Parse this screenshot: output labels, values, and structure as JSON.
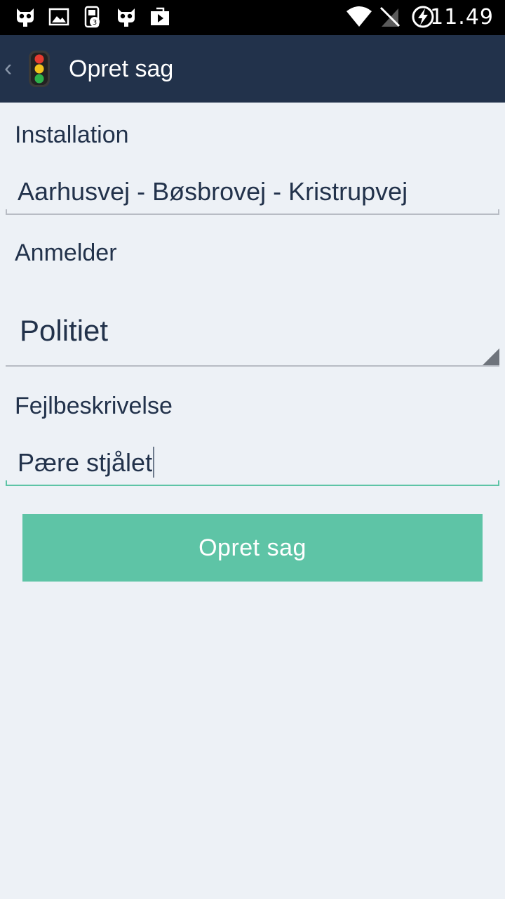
{
  "status_bar": {
    "time": "11.49",
    "notification_icons": [
      "cyanogen-mod-icon",
      "image-icon",
      "sim-notification-icon",
      "cyanogen-mod-icon",
      "video-store-icon"
    ],
    "notification_badge": "3",
    "system_icons": [
      "wifi-icon",
      "no-signal-icon",
      "battery-charging-icon"
    ]
  },
  "action_bar": {
    "title": "Opret sag",
    "back_icon": "chevron-left-icon",
    "logo_icon": "traffic-light-icon",
    "background": "#22324b"
  },
  "form": {
    "installation": {
      "label": "Installation",
      "value": "Aarhusvej - Bøsbrovej - Kristrupvej"
    },
    "reporter": {
      "label": "Anmelder",
      "selected": "Politiet"
    },
    "description": {
      "label": "Fejlbeskrivelse",
      "value": "Pære stjålet"
    },
    "submit_label": "Opret sag"
  },
  "colors": {
    "accent": "#5ec4a6",
    "text": "#22324b",
    "background": "#edf1f6"
  }
}
